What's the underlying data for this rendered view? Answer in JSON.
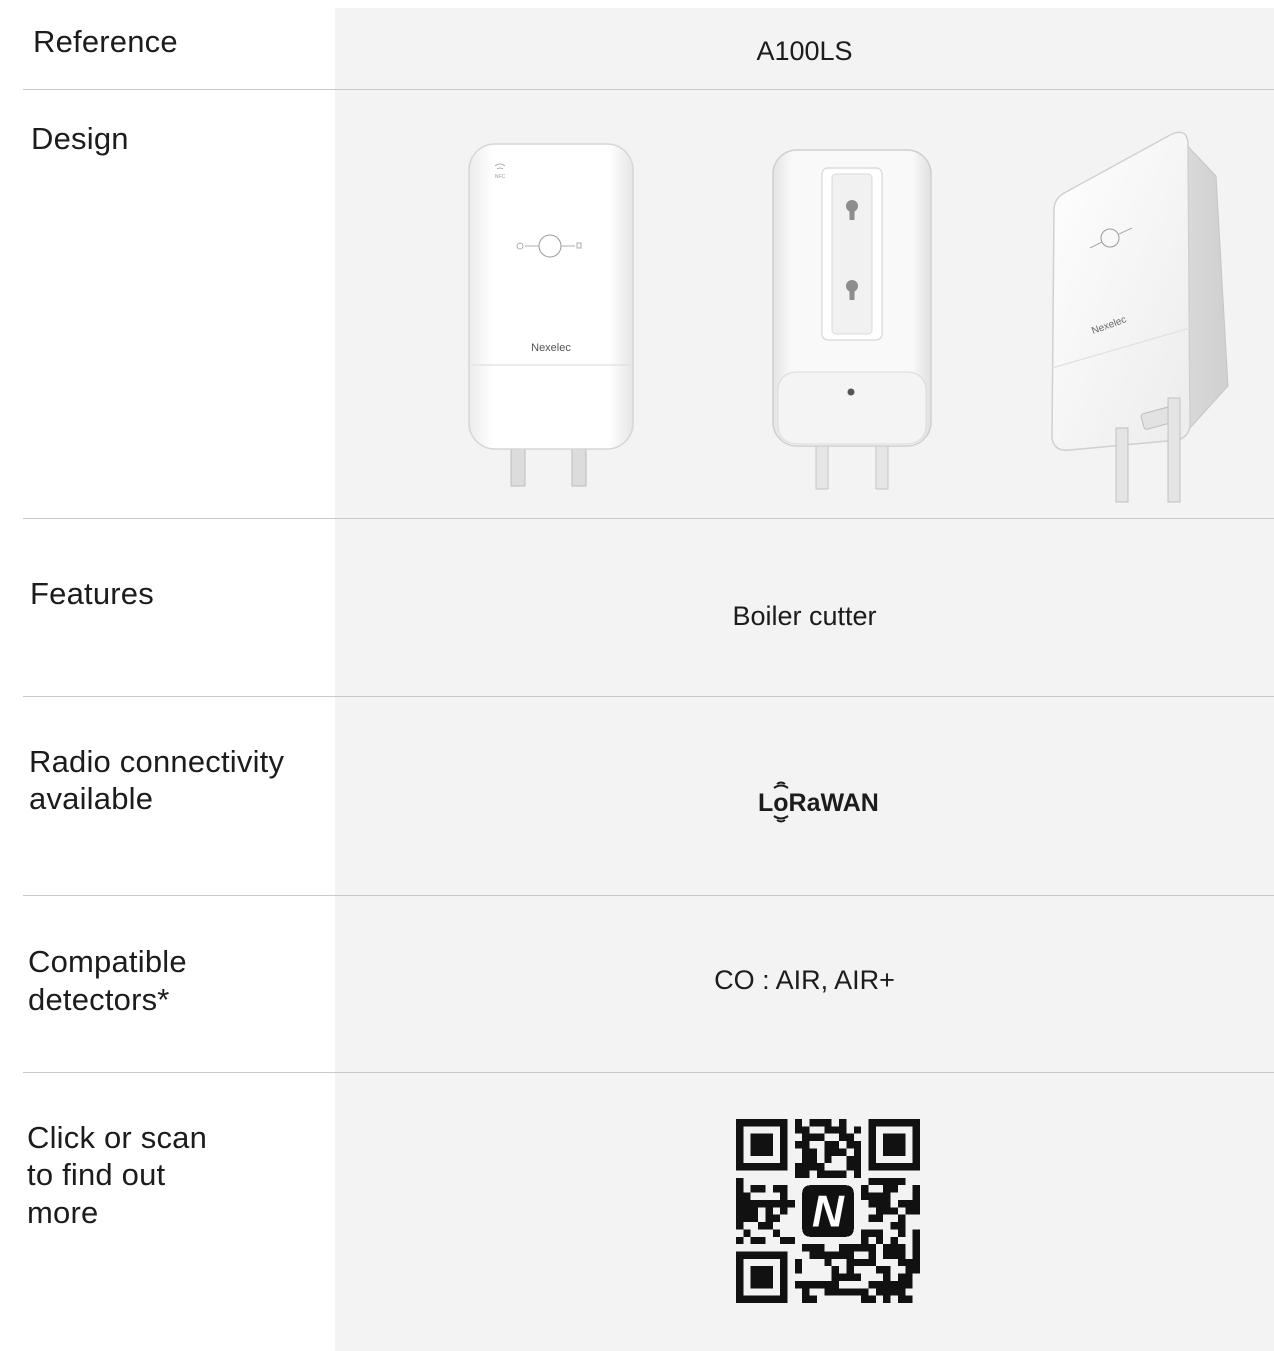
{
  "rows": {
    "reference": {
      "label": "Reference",
      "value": "A100LS"
    },
    "design": {
      "label": "Design",
      "images": [
        {
          "name": "front view",
          "brand_text": "Nexelec",
          "nfc_text": "NFC"
        },
        {
          "name": "back view"
        },
        {
          "name": "perspective view",
          "brand_text": "Nexelec"
        }
      ]
    },
    "features": {
      "label": "Features",
      "value": "Boiler cutter"
    },
    "radio": {
      "label_line1": "Radio connectivity",
      "label_line2": "available",
      "logo_text": "LoRaWAN",
      "logo_icon": "lorawan-logo"
    },
    "compatible": {
      "label_line1": "Compatible",
      "label_line2": "detectors*",
      "value": "CO : AIR, AIR+"
    },
    "more": {
      "label_line1": "Click or scan",
      "label_line2": "to find out",
      "label_line3": "more",
      "qr_icon": "qr-code-icon",
      "qr_center_text": "N"
    }
  },
  "colors": {
    "value_background": "#f3f3f3",
    "divider": "#c9c9c9",
    "text": "#1c1c1c"
  }
}
